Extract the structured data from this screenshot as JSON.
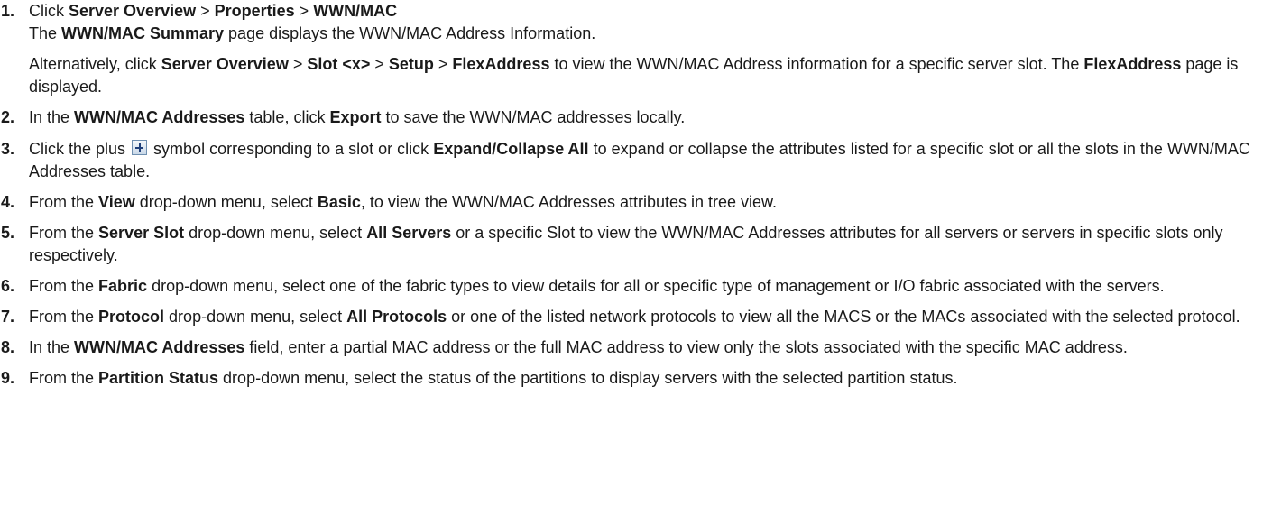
{
  "steps": [
    {
      "num": "1.",
      "p1": [
        {
          "t": "Click "
        },
        {
          "b": "Server Overview"
        },
        {
          "t": " > "
        },
        {
          "b": "Properties"
        },
        {
          "t": " > "
        },
        {
          "b": "WWN/MAC"
        }
      ],
      "p1b": [
        {
          "t": "The "
        },
        {
          "b": "WWN/MAC Summary"
        },
        {
          "t": " page displays the WWN/MAC Address Information."
        }
      ],
      "p2": [
        {
          "t": "Alternatively, click "
        },
        {
          "b": "Server Overview"
        },
        {
          "t": " > "
        },
        {
          "b": "Slot <x>"
        },
        {
          "t": " > "
        },
        {
          "b": "Setup"
        },
        {
          "t": " > "
        },
        {
          "b": "FlexAddress"
        },
        {
          "t": " to view the WWN/MAC Address information for a specific server slot. The "
        },
        {
          "b": "FlexAddress"
        },
        {
          "t": " page is displayed."
        }
      ]
    },
    {
      "num": "2.",
      "p1": [
        {
          "t": "In the "
        },
        {
          "b": "WWN/MAC Addresses"
        },
        {
          "t": " table, click "
        },
        {
          "b": "Export"
        },
        {
          "t": " to save the WWN/MAC addresses locally."
        }
      ]
    },
    {
      "num": "3.",
      "p1": [
        {
          "t": "Click the plus "
        },
        {
          "icon": "plus-icon"
        },
        {
          "t": " symbol corresponding to a slot or click "
        },
        {
          "b": "Expand/Collapse All"
        },
        {
          "t": " to expand or collapse the attributes listed for a specific slot or all the slots in the WWN/MAC Addresses table."
        }
      ]
    },
    {
      "num": "4.",
      "p1": [
        {
          "t": "From the "
        },
        {
          "b": "View"
        },
        {
          "t": " drop-down menu, select "
        },
        {
          "b": "Basic"
        },
        {
          "t": ", to view the WWN/MAC Addresses attributes in tree view."
        }
      ]
    },
    {
      "num": "5.",
      "p1": [
        {
          "t": "From the "
        },
        {
          "b": "Server Slot"
        },
        {
          "t": " drop-down menu, select "
        },
        {
          "b": "All Servers"
        },
        {
          "t": " or a specific Slot to view the WWN/MAC Addresses attributes for all servers or servers in specific slots only respectively."
        }
      ]
    },
    {
      "num": "6.",
      "p1": [
        {
          "t": "From the "
        },
        {
          "b": "Fabric"
        },
        {
          "t": " drop-down menu, select one of the fabric types to view details for all or specific type of management or I/O fabric associated with the servers."
        }
      ]
    },
    {
      "num": "7.",
      "p1": [
        {
          "t": "From the "
        },
        {
          "b": "Protocol"
        },
        {
          "t": " drop-down menu, select "
        },
        {
          "b": "All Protocols"
        },
        {
          "t": " or one of the listed network protocols to view all the MACS or the MACs associated with the selected protocol."
        }
      ]
    },
    {
      "num": "8.",
      "p1": [
        {
          "t": "In the "
        },
        {
          "b": "WWN/MAC Addresses"
        },
        {
          "t": " field, enter a partial MAC address or the full MAC address to view only the slots associated with the specific MAC address."
        }
      ]
    },
    {
      "num": "9.",
      "p1": [
        {
          "t": "From the "
        },
        {
          "b": "Partition Status"
        },
        {
          "t": " drop-down menu, select the status of the partitions to display servers with the selected partition status."
        }
      ]
    }
  ]
}
